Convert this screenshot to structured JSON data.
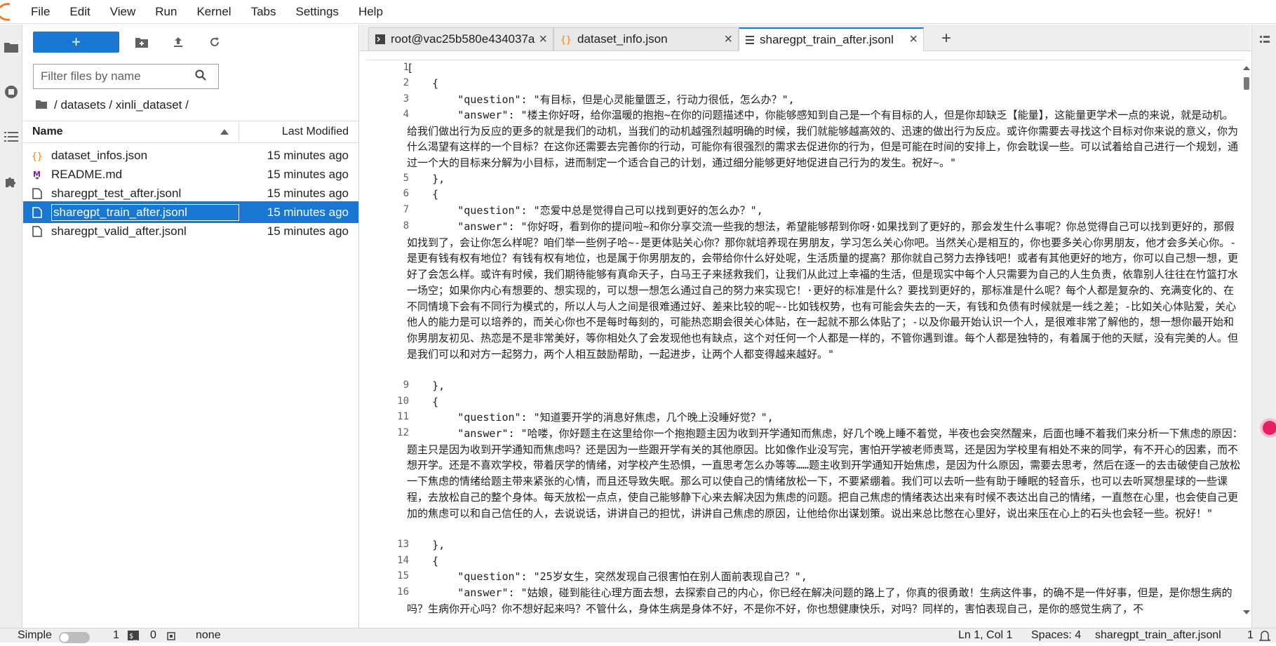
{
  "menu": [
    "File",
    "Edit",
    "View",
    "Run",
    "Kernel",
    "Tabs",
    "Settings",
    "Help"
  ],
  "filebrowser": {
    "new_label": "+",
    "filter_placeholder": "Filter files by name",
    "breadcrumb": "/ datasets / xinli_dataset /",
    "col_name": "Name",
    "col_modified": "Last Modified",
    "files": [
      {
        "name": "dataset_infos.json",
        "modified": "15 minutes ago",
        "icon": "json-icon"
      },
      {
        "name": "README.md",
        "modified": "15 minutes ago",
        "icon": "markdown-icon"
      },
      {
        "name": "sharegpt_test_after.jsonl",
        "modified": "15 minutes ago",
        "icon": "file-icon"
      },
      {
        "name": "sharegpt_train_after.jsonl",
        "modified": "15 minutes ago",
        "icon": "file-icon"
      },
      {
        "name": "sharegpt_valid_after.jsonl",
        "modified": "15 minutes ago",
        "icon": "file-icon"
      }
    ]
  },
  "tabs": [
    {
      "label": "root@vac25b580e434037a",
      "icon": "terminal-icon"
    },
    {
      "label": "dataset_info.json",
      "icon": "json-icon"
    },
    {
      "label": "sharegpt_train_after.jsonl",
      "icon": "file-icon"
    }
  ],
  "editor": {
    "line_numbers": [
      "1",
      "2",
      "3",
      "4",
      "5",
      "6",
      "7",
      "8",
      "9",
      "10",
      "11",
      "12",
      "13",
      "14",
      "15",
      "16"
    ],
    "lines": [
      "[",
      "    {",
      "        \"question\": \"有目标，但是心灵能量匮乏，行动力很低，怎么办？\",",
      "        \"answer\": \"楼主你好呀，给你温暖的抱抱~在你的问题描述中，你能够感知到自己是一个有目标的人，但是你却缺乏【能量】，这能量更学术一点的来说，就是动机。给我们做出行为反应的更多的就是我们的动机，当我们的动机越强烈越明确的时候，我们就能够越高效的、迅速的做出行为反应。或许你需要去寻找这个目标对你来说的意义，你为什么渴望有这样的一个目标？在这你还需要去完善你的行动，可能你有很强烈的需求去促进你的行为，但是可能在时间的安排上，你会耽误一些。可以试着给自己进行一个规划，通过一个大的目标来分解为小目标，进而制定一个适合自己的计划，通过细分能够更好地促进自己行为的发生。祝好~。\"",
      "    },",
      "    {",
      "        \"question\": \"恋爱中总是觉得自己可以找到更好的怎么办？\",",
      "        \"answer\": \"你好呀，看到你的提问啦~和你分享交流一些我的想法，希望能够帮到你呀·如果找到了更好的，那会发生什么事呢？你总觉得自己可以找到更好的，那假如找到了，会让你怎么样呢？咱们举一些例子哈~-是更体贴关心你？那你就培养现在男朋友，学习怎么关心你吧。当然关心是相互的，你也要多关心你男朋友，他才会多关心你。-是更有钱有权有地位？有钱有权有地位，也是属于你男朋友的，会带给你什么好处呢，生活质量的提高？那你就自己努力去挣钱吧！或者有其他更好的地方，你可以自己想一想，更好了会怎么样。或许有时候，我们期待能够有真命天子，白马王子来拯救我们，让我们从此过上幸福的生活，但是现实中每个人只需要为自己的人生负责，依靠别人往往在竹篮打水一场空；如果你内心有想要的、想实现的，可以想一想怎么通过自己的努力来实现它！·更好的标准是什么？要找到更好的，那标准是什么呢？每个人都是复杂的、充满变化的、在不同情境下会有不同行为模式的，所以人与人之间是很难通过好、差来比较的呢~-比如钱权势，也有可能会失去的一天，有钱和负债有时候就是一线之差；-比如关心体贴爱，关心他人的能力是可以培养的，而关心你也不是每时每刻的，可能热恋期会很关心体贴，在一起就不那么体贴了；-以及你最开始认识一个人，是很难非常了解他的，想一想你最开始和你男朋友初见、热恋是不是非常美好，等你相处久了会发现他也有缺点，这个对任何一个人都是一样的，不管你遇到谁。每个人都是独特的，有着属于他的天赋，没有完美的人。但是我们可以和对方一起努力，两个人相互鼓励帮助，一起进步，让两个人都变得越来越好。\"",
      "    },",
      "    {",
      "        \"question\": \"知道要开学的消息好焦虑，几个晚上没睡好觉？\",",
      "        \"answer\": \"哈喽，你好题主在这里给你一个抱抱题主因为收到开学通知而焦虑，好几个晚上睡不着觉，半夜也会突然醒来，后面也睡不着我们来分析一下焦虑的原因：题主只是因为收到开学通知而焦虑吗？还是因为一些跟开学有关的其他原因。比如像作业没写完，害怕开学被老师责骂，还是因为学校里有相处不来的同学，有不开心的因素，而不想开学。还是不喜欢学校，带着厌学的情绪，对学校产生恐惧，一直思考怎么办等等……题主收到开学通知开始焦虑，是因为什么原因，需要去思考，然后在逐一的去击破使自己放松一下焦虑的情绪给题主带来紧张的心情，而且还导致失眠。那么可以使自己的情绪放松一下，不要紧绷着。我们可以去听一些有助于睡眠的轻音乐，也可以去听冥想星球的一些课程，去放松自己的整个身体。每天放松一点点，使自己能够静下心来去解决因为焦虑的问题。把自己焦虑的情绪表达出来有时候不表达出自己的情绪，一直憋在心里，也会使自己更加的焦虑可以和自己信任的人，去说说话，讲讲自己的担忧，讲讲自己焦虑的原因，让他给你出谋划策。说出来总比憋在心里好，说出来压在心上的石头也会轻一些。祝好！\"",
      "    },",
      "    {",
      "        \"question\": \"25岁女生，突然发现自己很害怕在别人面前表现自己？\",",
      "        \"answer\": \"姑娘，碰到能往心理方面去想，去探索自己的内心，你已经在解决问题的路上了，你真的很勇敢！生病这件事，的确不是一件好事，但是，是你想生病的吗？生病你开心吗？你不想好起来吗？不管什么，身体生病是身体不好，不是你不好，你也想健康快乐，对吗？同样的，害怕表现自己，是你的感觉生病了，不"
    ]
  },
  "status": {
    "mode_label": "Simple",
    "terminals": "1",
    "kernels": "0",
    "kernel_name": "none",
    "cursor": "Ln 1, Col 1",
    "spaces": "Spaces: 4",
    "filename": "sharegpt_train_after.jsonl",
    "right_count": "1"
  },
  "colors": {
    "accent": "#1976d2",
    "json_icon": "#f57c00",
    "markdown_icon": "#7b1fa2"
  }
}
